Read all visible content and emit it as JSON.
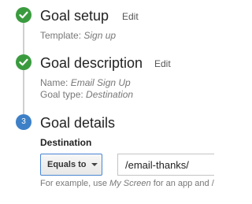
{
  "steps": [
    {
      "title": "Goal setup",
      "edit_label": "Edit",
      "state": "complete",
      "details": [
        {
          "label": "Template:",
          "value": "Sign up"
        }
      ]
    },
    {
      "title": "Goal description",
      "edit_label": "Edit",
      "state": "complete",
      "details": [
        {
          "label": "Name:",
          "value": "Email Sign Up"
        },
        {
          "label": "Goal type:",
          "value": "Destination"
        }
      ]
    },
    {
      "title": "Goal details",
      "number": "3",
      "state": "current"
    }
  ],
  "destination": {
    "label": "Destination",
    "match_type": "Equals to",
    "value": "/email-thanks/",
    "hint": {
      "prefix": "For example, use",
      "example": "My Screen",
      "suffix": "for an app and /"
    }
  },
  "colors": {
    "complete": "#3a9b3e",
    "current": "#3d80c7",
    "connector": "#cfcfcf",
    "select_border": "#4a86d4"
  },
  "icons": {
    "complete": "check-icon",
    "dropdown": "chevron-down-icon"
  }
}
